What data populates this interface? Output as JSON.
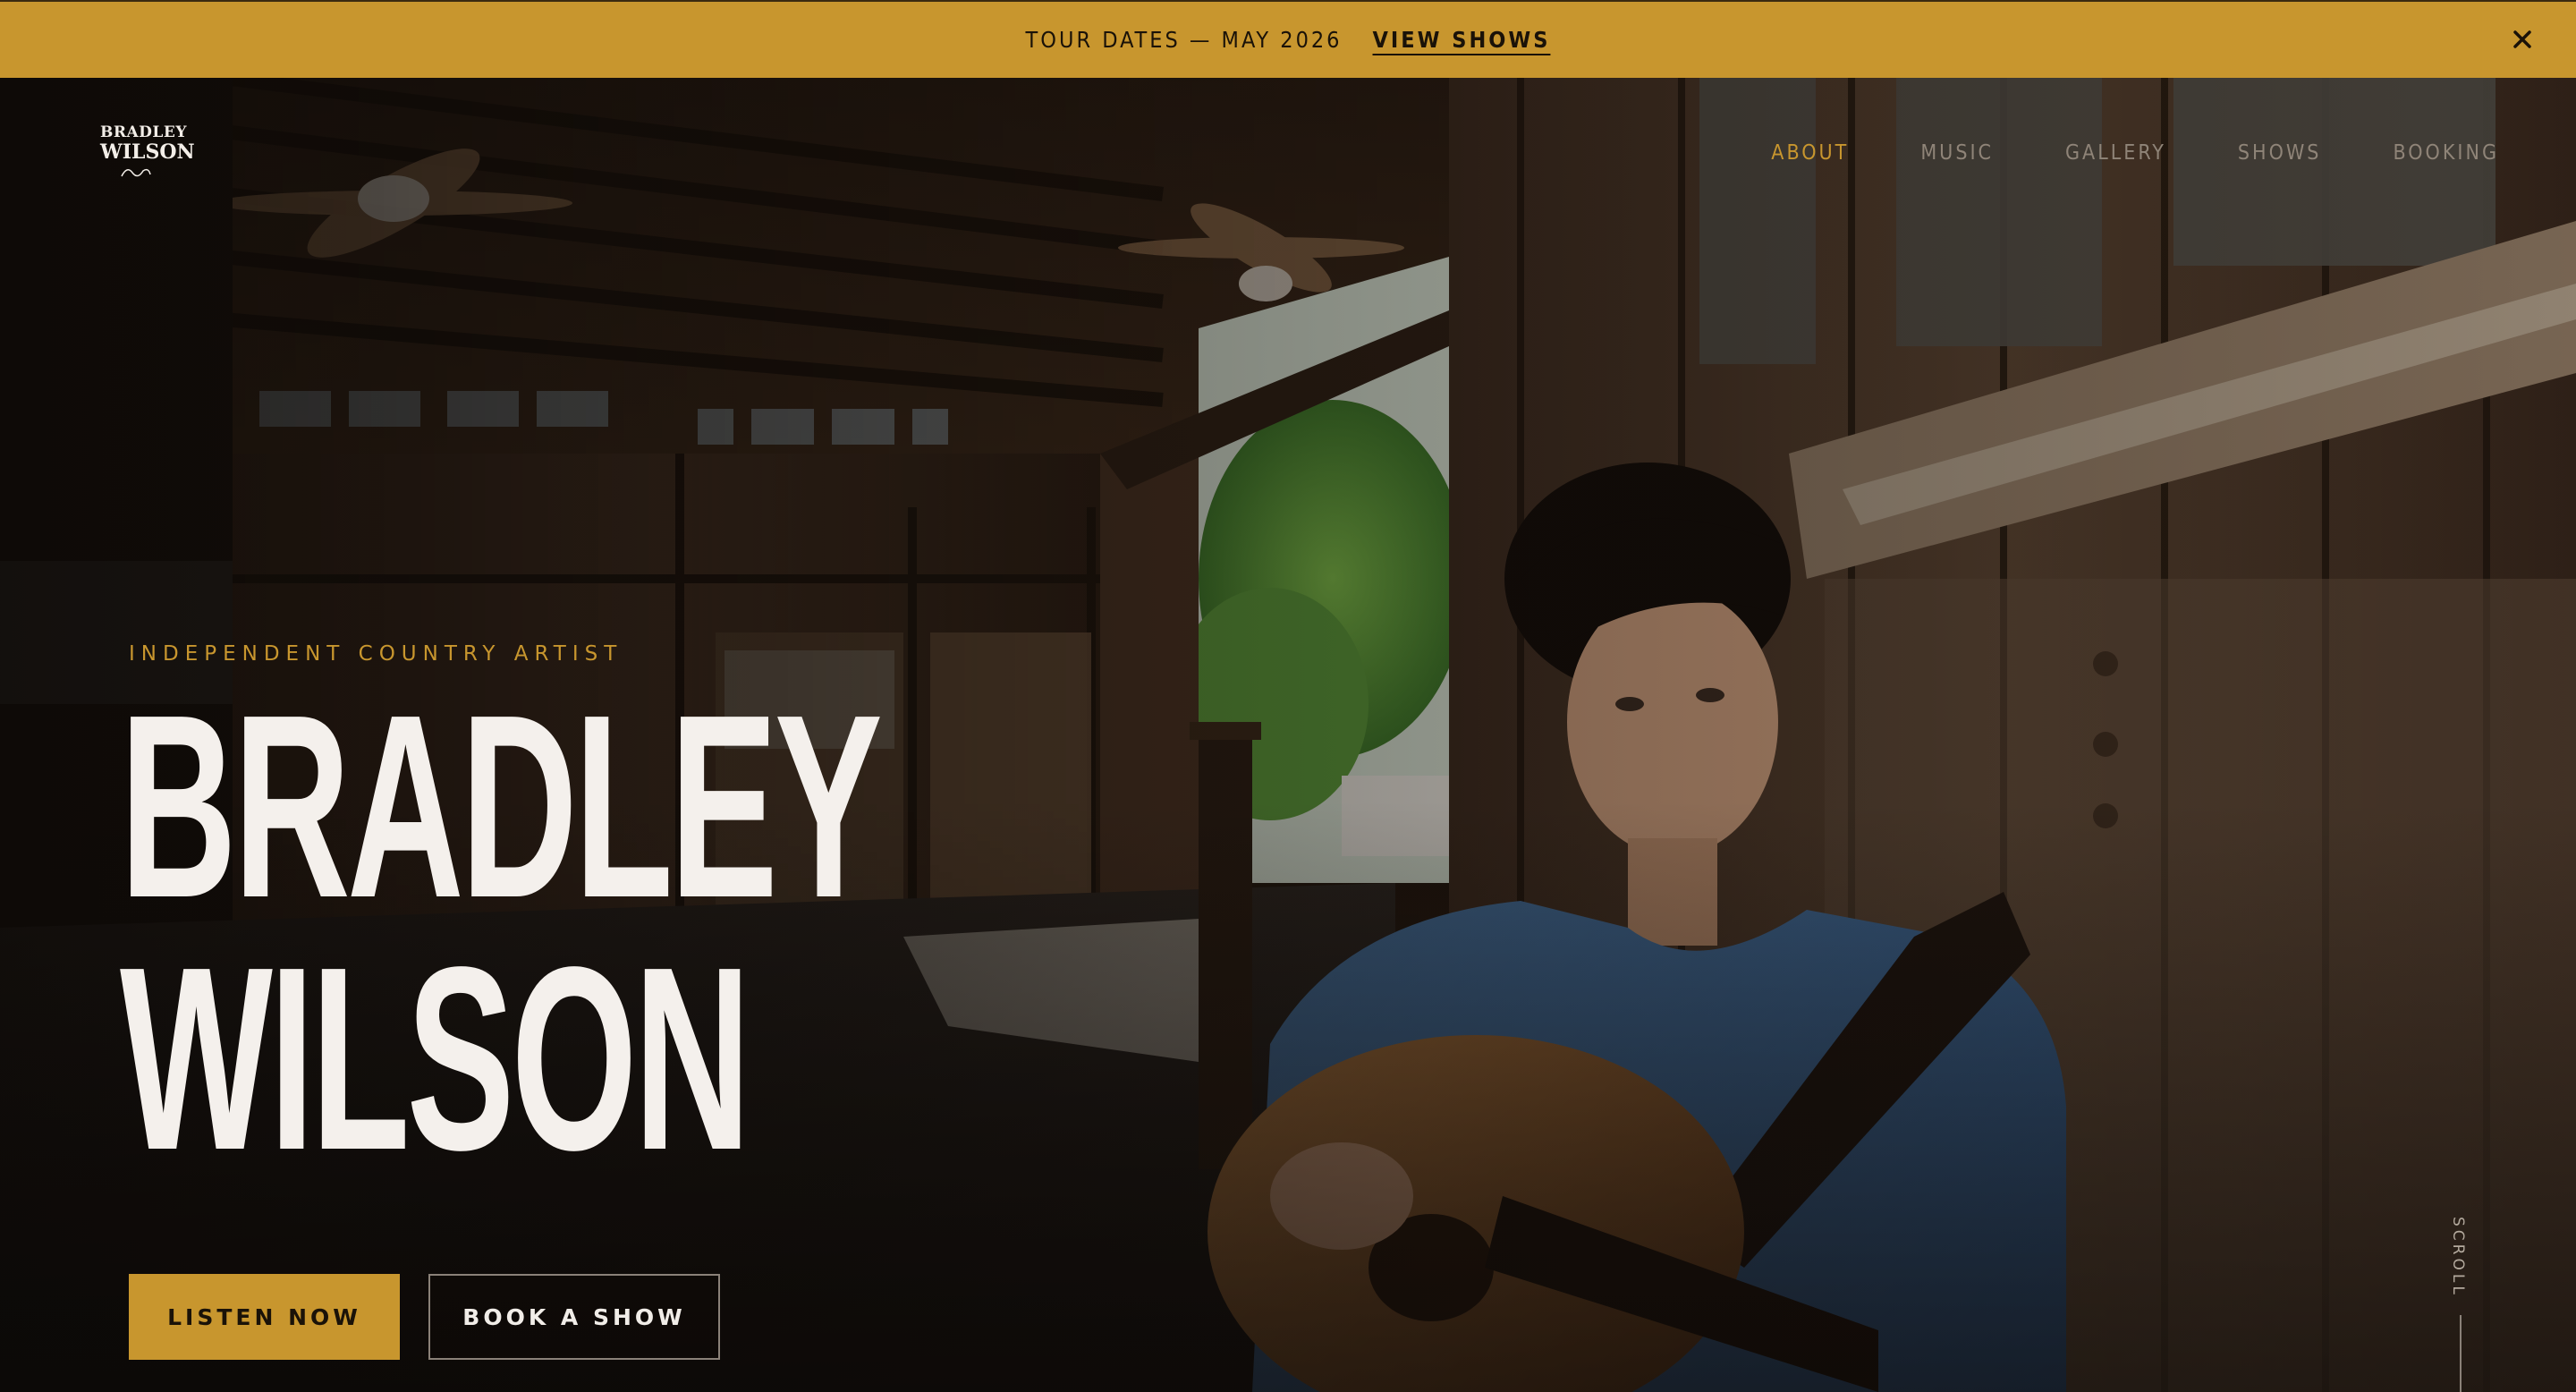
{
  "announcement": {
    "text": "TOUR DATES — MAY 2026",
    "link_label": "VIEW SHOWS",
    "close_icon": "close-icon"
  },
  "logo": {
    "line1": "BRADLEY",
    "line2": "WILSON"
  },
  "nav": {
    "items": [
      {
        "label": "ABOUT",
        "active": true
      },
      {
        "label": "MUSIC",
        "active": false
      },
      {
        "label": "GALLERY",
        "active": false
      },
      {
        "label": "SHOWS",
        "active": false
      },
      {
        "label": "BOOKING",
        "active": false
      }
    ]
  },
  "hero": {
    "eyebrow": "INDEPENDENT COUNTRY ARTIST",
    "name_line1": "BRADLEY",
    "name_line2": "WILSON",
    "primary_button": "LISTEN NOW",
    "secondary_button": "BOOK A SHOW",
    "scroll_label": "SCROLL"
  },
  "colors": {
    "accent": "#c8962e",
    "headline": "#f4f0ec",
    "background": "#0f0b08"
  }
}
